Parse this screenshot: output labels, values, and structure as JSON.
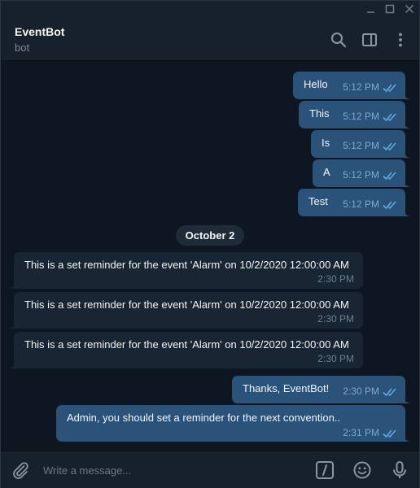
{
  "colors": {
    "background": "#0e1621",
    "panel": "#17212b",
    "outgoing_bubble": "#2b5278",
    "incoming_bubble": "#182533",
    "accent": "#5fa8e6",
    "muted_text": "#7d8b99"
  },
  "window": {
    "controls": [
      "minimize-icon",
      "maximize-icon",
      "close-icon"
    ]
  },
  "header": {
    "title": "EventBot",
    "status": "bot",
    "actions": [
      "search-icon",
      "sidebar-toggle-icon",
      "more-vertical-icon"
    ]
  },
  "messages": {
    "outgoing_1": {
      "text": "Hello",
      "time": "5:12 PM",
      "read": true
    },
    "outgoing_2": {
      "text": "This",
      "time": "5:12 PM",
      "read": true
    },
    "outgoing_3": {
      "text": "Is",
      "time": "5:12 PM",
      "read": true
    },
    "outgoing_4": {
      "text": "A",
      "time": "5:12 PM",
      "read": true
    },
    "outgoing_5": {
      "text": "Test",
      "time": "5:12 PM",
      "read": true
    },
    "date_separator": "October 2",
    "incoming_1": {
      "text": "This is a set reminder for the event 'Alarm' on 10/2/2020 12:00:00 AM",
      "time": "2:30 PM"
    },
    "incoming_2": {
      "text": "This is a set reminder for the event 'Alarm' on 10/2/2020 12:00:00 AM",
      "time": "2:30 PM"
    },
    "incoming_3": {
      "text": "This is a set reminder for the event 'Alarm' on 10/2/2020 12:00:00 AM",
      "time": "2:30 PM"
    },
    "outgoing_6": {
      "text": "Thanks, EventBot!",
      "time": "2:30 PM",
      "read": true
    },
    "outgoing_7": {
      "text": "Admin, you should set a reminder for the next convention..",
      "time": "2:31 PM",
      "read": true
    }
  },
  "composer": {
    "placeholder": "Write a message...",
    "value": "",
    "icons": [
      "attach-icon",
      "bot-commands-icon",
      "emoji-icon",
      "microphone-icon"
    ]
  }
}
